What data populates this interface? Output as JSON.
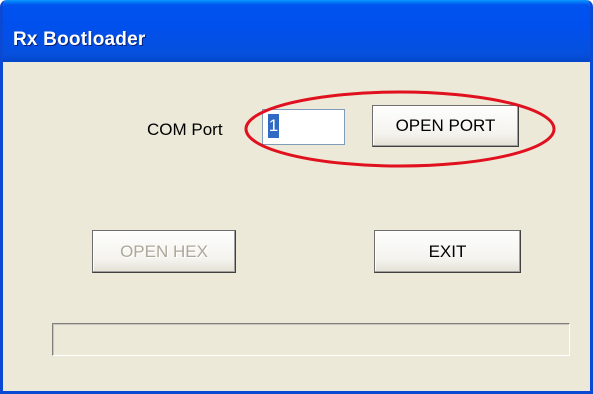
{
  "window": {
    "title": "Rx Bootloader"
  },
  "com_port": {
    "label": "COM Port",
    "value": "1"
  },
  "buttons": {
    "open_port": "OPEN PORT",
    "open_hex": "OPEN HEX",
    "exit": "EXIT"
  },
  "progress": {
    "value": 0
  },
  "annotation": {
    "color": "#e0101e"
  },
  "colors": {
    "title_bar": "#0050ee",
    "client_bg": "#ece9d8",
    "selection": "#316ac5",
    "disabled_text": "#aca899"
  }
}
